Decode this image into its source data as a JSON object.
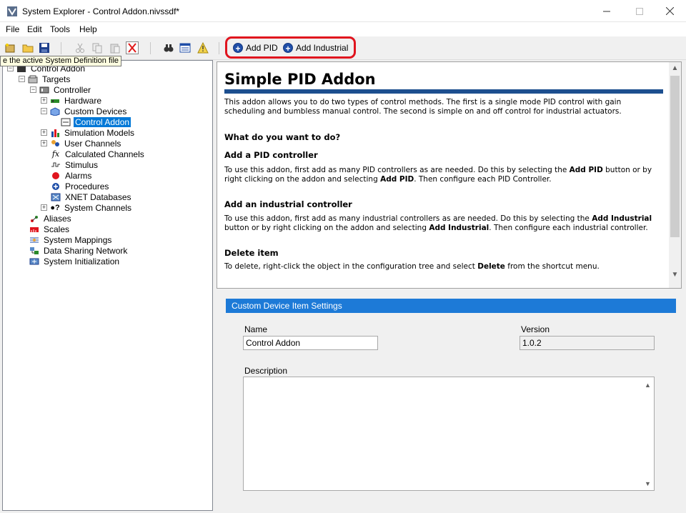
{
  "window": {
    "title": "System Explorer - Control Addon.nivssdf*"
  },
  "menu": [
    "File",
    "Edit",
    "Tools",
    "Help"
  ],
  "toolbar": {
    "tooltip": "e the active System Definition file",
    "add_pid": "Add PID",
    "add_industrial": "Add Industrial",
    "colors": {
      "highlight": "#e0141e",
      "add_icon": "#1f4ea8"
    }
  },
  "tree": [
    {
      "label": "Control Addon",
      "icon": "system-definition-icon"
    },
    {
      "label": "Targets",
      "icon": "targets-icon"
    },
    {
      "label": "Controller",
      "icon": "controller-icon"
    },
    {
      "label": "Hardware",
      "icon": "hardware-icon"
    },
    {
      "label": "Custom Devices",
      "icon": "custom-devices-icon"
    },
    {
      "label": "Control Addon",
      "icon": "custom-device-icon",
      "selected": true
    },
    {
      "label": "Simulation Models",
      "icon": "simulation-models-icon"
    },
    {
      "label": "User Channels",
      "icon": "user-channels-icon"
    },
    {
      "label": "Calculated Channels",
      "icon": "calculated-channels-icon"
    },
    {
      "label": "Stimulus",
      "icon": "stimulus-icon"
    },
    {
      "label": "Alarms",
      "icon": "alarms-icon"
    },
    {
      "label": "Procedures",
      "icon": "procedures-icon"
    },
    {
      "label": "XNET Databases",
      "icon": "xnet-icon"
    },
    {
      "label": "System Channels",
      "icon": "system-channels-icon"
    },
    {
      "label": "Aliases",
      "icon": "aliases-icon"
    },
    {
      "label": "Scales",
      "icon": "scales-icon"
    },
    {
      "label": "System Mappings",
      "icon": "system-mappings-icon"
    },
    {
      "label": "Data Sharing Network",
      "icon": "data-sharing-icon"
    },
    {
      "label": "System Initialization",
      "icon": "system-init-icon"
    }
  ],
  "doc": {
    "title": "Simple PID Addon",
    "intro": "This addon allows you to do two types of control methods. The first is a single mode PID control with gain scheduling and bumbless manual control. The second is simple on and off control for industrial actuators.",
    "q": "What do you want to do?",
    "pid_h": "Add a PID controller",
    "pid_p1": "To use this addon, first add as many PID controllers as are needed. Do this by selecting the ",
    "pid_b1": "Add PID",
    "pid_p2": " button or by right clicking on the addon and selecting ",
    "pid_b2": "Add PID",
    "pid_p3": ". Then configure each PID Controller.",
    "ind_h": "Add an industrial controller",
    "ind_p1": "To use this addon, first add as many industrial controllers as are needed. Do this by selecting the ",
    "ind_b1": "Add Industrial",
    "ind_p2": " button or by right clicking on the addon and selecting ",
    "ind_b2": "Add Industrial",
    "ind_p3": ". Then configure each industrial controller.",
    "del_h": "Delete item",
    "del_p1": "To delete, right-click the object in the configuration tree and select ",
    "del_b": "Delete",
    "del_p2": " from the shortcut menu."
  },
  "settings": {
    "header": "Custom Device Item Settings",
    "name_label": "Name",
    "name_value": "Control Addon",
    "version_label": "Version",
    "version_value": "1.0.2",
    "description_label": "Description",
    "description_value": ""
  }
}
